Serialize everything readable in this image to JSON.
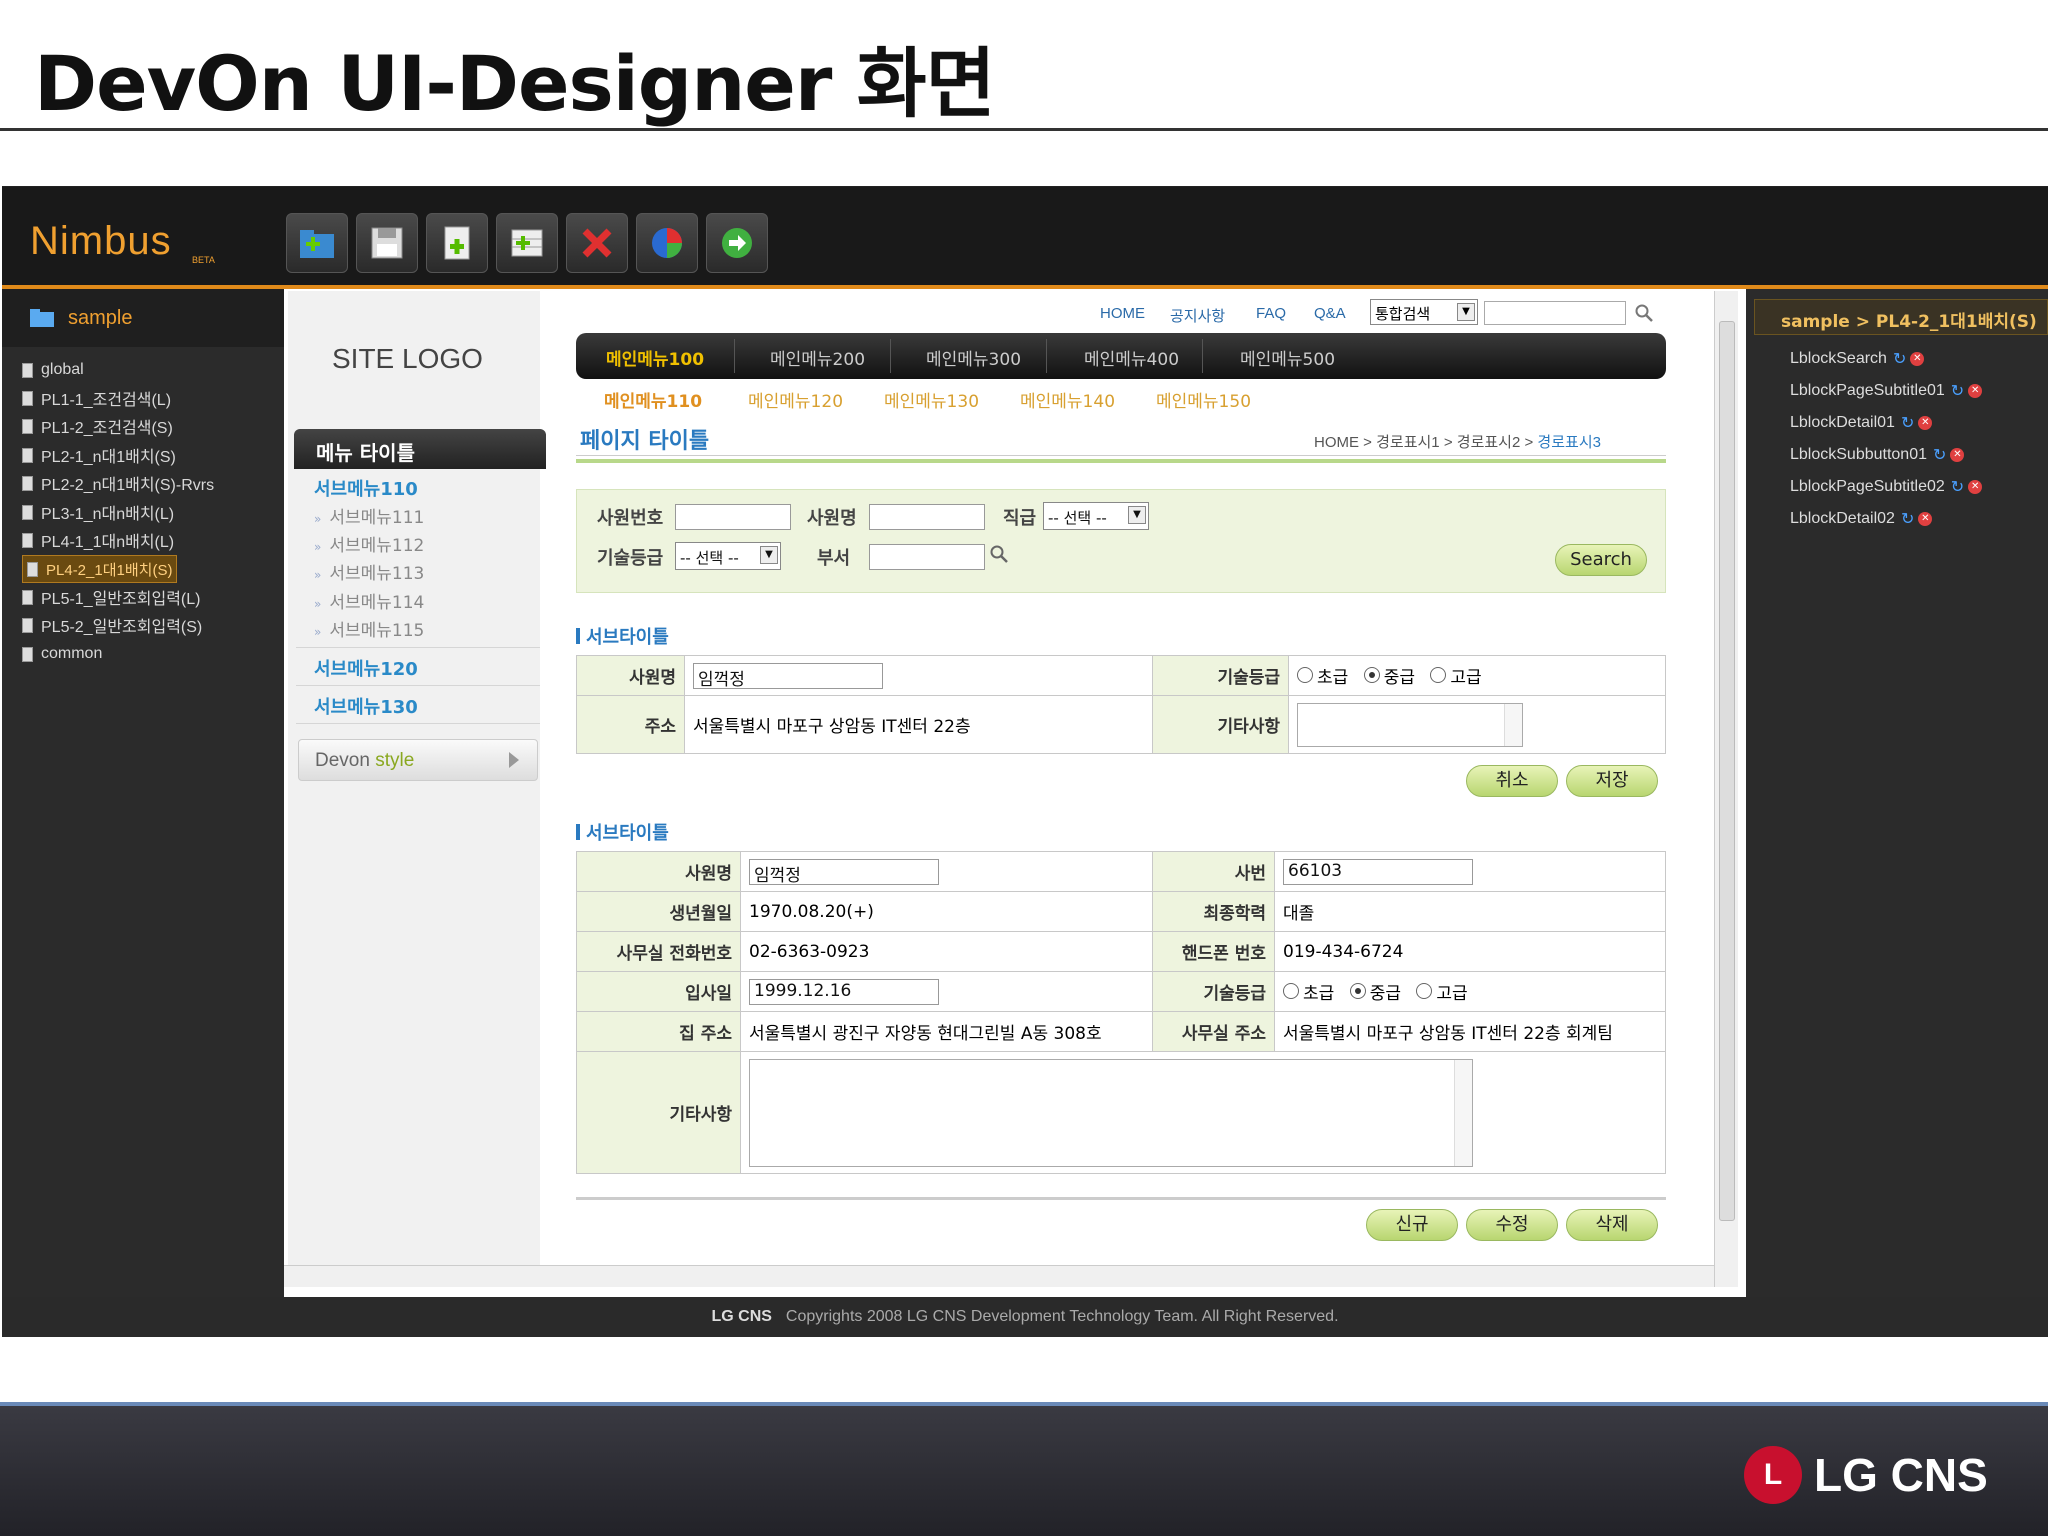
{
  "slide": {
    "title": "DevOn UI-Designer 화면"
  },
  "app": {
    "brand": "Nimbus",
    "brand_sub": "BETA"
  },
  "toolbar": {
    "icons": [
      "folder-add-icon",
      "save-icon",
      "new-page-icon",
      "add-row-icon",
      "delete-icon",
      "color-wheel-icon",
      "run-icon"
    ]
  },
  "tree": {
    "root": "sample",
    "items": [
      "global",
      "PL1-1_조건검색(L)",
      "PL1-2_조건검색(S)",
      "PL2-1_n대1배치(S)",
      "PL2-2_n대1배치(S)-Rvrs",
      "PL3-1_n대n배치(L)",
      "PL4-1_1대n배치(L)",
      "PL4-2_1대1배치(S)",
      "PL5-1_일반조회입력(L)",
      "PL5-2_일반조회입력(S)",
      "common"
    ],
    "selected_index": 7
  },
  "page": {
    "site_logo": "SITE LOGO",
    "top_links": [
      "HOME",
      "공지사항",
      "FAQ",
      "Q&A"
    ],
    "search_select": "통합검색",
    "main_menu": [
      "메인메뉴100",
      "메인메뉴200",
      "메인메뉴300",
      "메인메뉴400",
      "메인메뉴500"
    ],
    "sub_menu": [
      "메인메뉴110",
      "메인메뉴120",
      "메인메뉴130",
      "메인메뉴140",
      "메인메뉴150"
    ],
    "menu_title": "메뉴 타이틀",
    "nav": {
      "h1": "서브메뉴110",
      "items": [
        "서브메뉴111",
        "서브메뉴112",
        "서브메뉴113",
        "서브메뉴114",
        "서브메뉴115"
      ],
      "h2": "서브메뉴120",
      "h3": "서브메뉴130",
      "devon": "Devon",
      "style": "style"
    },
    "page_title": "페이지 타이틀",
    "breadcrumb": {
      "home": "HOME",
      "p1": "경로표시1",
      "p2": "경로표시2",
      "p3": "경로표시3"
    },
    "search": {
      "emp_no": "사원번호",
      "emp_name": "사원명",
      "position": "직급",
      "position_select": "-- 선택 --",
      "skill": "기술등급",
      "skill_select": "-- 선택 --",
      "dept": "부서",
      "search_btn": "Search"
    },
    "sub_title": "서브타이틀",
    "form1": {
      "name_label": "사원명",
      "name_value": "임꺽정",
      "skill_label": "기술등급",
      "r1": "초급",
      "r2": "중급",
      "r3": "고급",
      "addr_label": "주소",
      "addr_value": "서울특별시 마포구 상암동 IT센터 22층",
      "etc_label": "기타사항",
      "cancel": "취소",
      "save": "저장"
    },
    "form2": {
      "name_label": "사원명",
      "name_value": "임꺽정",
      "emp_label": "사번",
      "emp_value": "66103",
      "birth_label": "생년월일",
      "birth_value": "1970.08.20(+)",
      "edu_label": "최종학력",
      "edu_value": "대졸",
      "tel_label": "사무실 전화번호",
      "tel_value": "02-6363-0923",
      "mobile_label": "핸드폰 번호",
      "mobile_value": "019-434-6724",
      "join_label": "입사일",
      "join_value": "1999.12.16",
      "skill_label": "기술등급",
      "r1": "초급",
      "r2": "중급",
      "r3": "고급",
      "home_label": "집 주소",
      "home_value": "서울특별시 광진구 자양동 현대그린빌 A동 308호",
      "office_label": "사무실 주소",
      "office_value": "서울특별시 마포구 상암동 IT센터 22층 회계팀",
      "etc_label": "기타사항",
      "new": "신규",
      "edit": "수정",
      "del": "삭제"
    }
  },
  "right_panel": {
    "header": "sample > PL4-2_1대1배치(S)",
    "items": [
      "LblockSearch",
      "LblockPageSubtitle01",
      "LblockDetail01",
      "LblockSubbutton01",
      "LblockPageSubtitle02",
      "LblockDetail02"
    ]
  },
  "footer": {
    "logo": "LG CNS",
    "text": "Copyrights 2008 LG CNS Development Technology Team. All Right Reserved."
  },
  "corp_logo": "LG CNS",
  "colors": {
    "accent": "#e08a1a",
    "link": "#2a7ac0",
    "form_label_bg": "#eef4de"
  }
}
